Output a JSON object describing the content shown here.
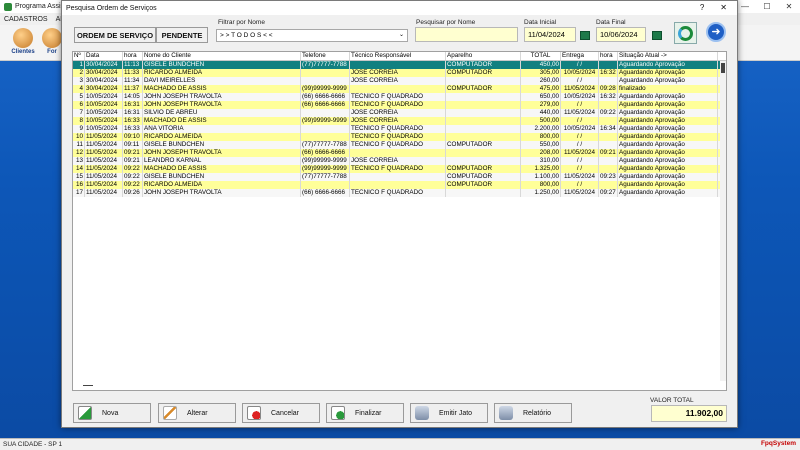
{
  "app": {
    "title": "Programa Assis",
    "menu": [
      "CADASTROS",
      "APA"
    ],
    "tools": [
      {
        "label": "Clientes"
      },
      {
        "label": "For"
      }
    ],
    "status_left": "SUA CIDADE - SP 1",
    "status_right": "FpqSystem"
  },
  "dialog": {
    "title": "Pesquisa Ordem de Serviços",
    "help": "?",
    "close": "✕",
    "header_btn1": "ORDEM DE SERVIÇO",
    "header_btn2": "PENDENTE",
    "filter_label": "Filtrar por Nome",
    "filter_value": "> > T O D O S < <",
    "search_label": "Pesquisar por Nome",
    "search_value": "",
    "date_start_label": "Data Inicial",
    "date_start": "11/04/2024",
    "date_end_label": "Data Final",
    "date_end": "10/06/2024"
  },
  "grid": {
    "columns": [
      "Nº",
      "Data",
      "hora",
      "Nome do Cliente",
      "Telefone",
      "Técnico Responsável",
      "Aparelho",
      "TOTAL",
      "Entrega",
      "hora",
      "Situação Atual ->"
    ],
    "rows": [
      [
        "1",
        "30/04/2024",
        "11:13",
        "GISELE BUNDCHEN",
        "(77)77777-7788",
        "",
        "COMPUTADOR",
        "450,00",
        " / / ",
        "",
        "Aguardando Aprovação"
      ],
      [
        "2",
        "30/04/2024",
        "11:33",
        "RICARDO ALMEIDA",
        "",
        "JOSE CORREIA",
        "COMPUTADOR",
        "305,00",
        "10/05/2024",
        "16:32",
        "Aguardando Aprovação"
      ],
      [
        "3",
        "30/04/2024",
        "11:34",
        "DAVI MEIRELLES",
        "",
        "JOSE CORREIA",
        "",
        "260,00",
        " / / ",
        "",
        "Aguardando Aprovação"
      ],
      [
        "4",
        "30/04/2024",
        "11:37",
        "MACHADO DE ASSIS",
        "(99)99999-9999",
        "",
        "COMPUTADOR",
        "475,00",
        "11/05/2024",
        "09:28",
        "finalizado"
      ],
      [
        "5",
        "10/05/2024",
        "14:05",
        "JOHN JOSEPH TRAVOLTA",
        "(66) 6666-6666",
        "TECNICO F QUADRADO",
        "",
        "650,00",
        "10/05/2024",
        "16:32",
        "Aguardando Aprovação"
      ],
      [
        "6",
        "10/05/2024",
        "16:31",
        "JOHN JOSEPH TRAVOLTA",
        "(66) 6666-6666",
        "TECNICO F QUADRADO",
        "",
        "279,00",
        " / / ",
        "",
        "Aguardando Aprovação"
      ],
      [
        "7",
        "10/05/2024",
        "16:31",
        "SILVIO DE ABREU",
        "",
        "JOSE CORREIA",
        "",
        "440,00",
        "11/05/2024",
        "09:22",
        "Aguardando Aprovação"
      ],
      [
        "8",
        "10/05/2024",
        "16:33",
        "MACHADO DE ASSIS",
        "(99)99999-9999",
        "JOSE CORREIA",
        "",
        "500,00",
        " / / ",
        "",
        "Aguardando Aprovação"
      ],
      [
        "9",
        "10/05/2024",
        "16:33",
        "ANA VITÓRIA",
        "",
        "TECNICO F QUADRADO",
        "",
        "2.200,00",
        "10/05/2024",
        "16:34",
        "Aguardando Aprovação"
      ],
      [
        "10",
        "11/05/2024",
        "09:10",
        "RICARDO ALMEIDA",
        "",
        "TECNICO F QUADRADO",
        "",
        "800,00",
        " / / ",
        "",
        "Aguardando Aprovação"
      ],
      [
        "11",
        "11/05/2024",
        "09:11",
        "GISELE BUNDCHEN",
        "(77)77777-7788",
        "TECNICO F QUADRADO",
        "COMPUTADOR",
        "550,00",
        " / / ",
        "",
        "Aguardando Aprovação"
      ],
      [
        "12",
        "11/05/2024",
        "09:21",
        "JOHN JOSEPH TRAVOLTA",
        "(66) 6666-6666",
        "",
        "",
        "208,00",
        "11/05/2024",
        "09:21",
        "Aguardando Aprovação"
      ],
      [
        "13",
        "11/05/2024",
        "09:21",
        "LEANDRO KARNAL",
        "(99)99999-9999",
        "JOSE CORREIA",
        "",
        "310,00",
        " / / ",
        "",
        "Aguardando Aprovação"
      ],
      [
        "14",
        "11/05/2024",
        "09:22",
        "MACHADO DE ASSIS",
        "(99)99999-9999",
        "TECNICO F QUADRADO",
        "COMPUTADOR",
        "1.325,00",
        " / / ",
        "",
        "Aguardando Aprovação"
      ],
      [
        "15",
        "11/05/2024",
        "09:22",
        "GISELE BUNDCHEN",
        "(77)77777-7788",
        "",
        "COMPUTADOR",
        "1.100,00",
        "11/05/2024",
        "09:23",
        "Aguardando Aprovação"
      ],
      [
        "16",
        "11/05/2024",
        "09:22",
        "RICARDO ALMEIDA",
        "",
        "",
        "COMPUTADOR",
        "800,00",
        " / / ",
        "",
        "Aguardando Aprovação"
      ],
      [
        "17",
        "11/05/2024",
        "09:26",
        "JOHN JOSEPH TRAVOLTA",
        "(66) 6666-6666",
        "TECNICO F QUADRADO",
        "",
        "1.250,00",
        "11/05/2024",
        "09:27",
        "Aguardando Aprovação"
      ]
    ]
  },
  "actions": {
    "new": "Nova",
    "edit": "Alterar",
    "cancel": "Cancelar",
    "finish": "Finalizar",
    "print": "Emitir Jato",
    "report": "Relatório"
  },
  "total": {
    "label": "VALOR TOTAL",
    "value": "11.902,00"
  },
  "colors": {
    "selected_row": "#128080",
    "alt_row": "#ffff99",
    "field_yellow": "#ffffd0"
  }
}
